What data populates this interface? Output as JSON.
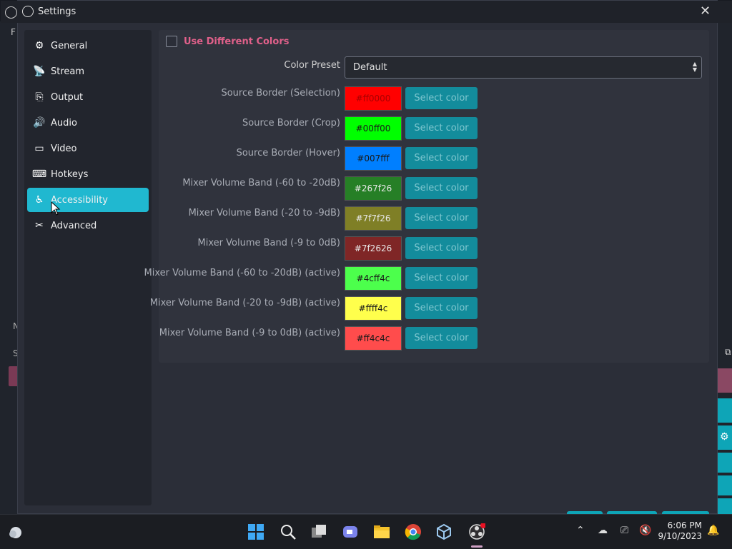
{
  "window": {
    "title": "Settings",
    "close_icon": "close-icon"
  },
  "background": {
    "left_letter_f": "F",
    "left_letter_m": "N",
    "left_letter_s": "S"
  },
  "sidebar": {
    "items": [
      {
        "label": "General",
        "icon": "gear-icon"
      },
      {
        "label": "Stream",
        "icon": "antenna-icon"
      },
      {
        "label": "Output",
        "icon": "output-icon"
      },
      {
        "label": "Audio",
        "icon": "speaker-icon"
      },
      {
        "label": "Video",
        "icon": "monitor-icon"
      },
      {
        "label": "Hotkeys",
        "icon": "keyboard-icon"
      },
      {
        "label": "Accessibility",
        "icon": "accessibility-icon",
        "active": true
      },
      {
        "label": "Advanced",
        "icon": "tools-icon"
      }
    ]
  },
  "content": {
    "use_different_colors": {
      "label": "Use Different Colors",
      "checked": false
    },
    "color_preset": {
      "label": "Color Preset",
      "value": "Default"
    },
    "select_color_label": "Select color",
    "rows": [
      {
        "label": "Source Border (Selection)",
        "hex": "#ff0000",
        "text_color": "#aa0000"
      },
      {
        "label": "Source Border (Crop)",
        "hex": "#00ff00",
        "text_color": "#1a1a1a"
      },
      {
        "label": "Source Border (Hover)",
        "hex": "#007fff",
        "text_color": "#1a1a1a"
      },
      {
        "label": "Mixer Volume Band (-60 to -20dB)",
        "hex": "#267f26",
        "text_color": "#e8e8e8"
      },
      {
        "label": "Mixer Volume Band (-20 to -9dB)",
        "hex": "#7f7f26",
        "text_color": "#e8e8e8"
      },
      {
        "label": "Mixer Volume Band (-9 to 0dB)",
        "hex": "#7f2626",
        "text_color": "#e8e8e8"
      },
      {
        "label": "Mixer Volume Band (-60 to -20dB) (active)",
        "hex": "#4cff4c",
        "text_color": "#1a1a1a"
      },
      {
        "label": "Mixer Volume Band (-20 to -9dB) (active)",
        "hex": "#ffff4c",
        "text_color": "#1a1a1a"
      },
      {
        "label": "Mixer Volume Band (-9 to 0dB) (active)",
        "hex": "#ff4c4c",
        "text_color": "#1a1a1a"
      }
    ]
  },
  "taskbar": {
    "clock_time": "6:06 PM",
    "clock_date": "9/10/2023"
  },
  "colors": {
    "accent": "#20b8d0",
    "button": "#138c9c",
    "highlight_label": "#e0608a"
  }
}
